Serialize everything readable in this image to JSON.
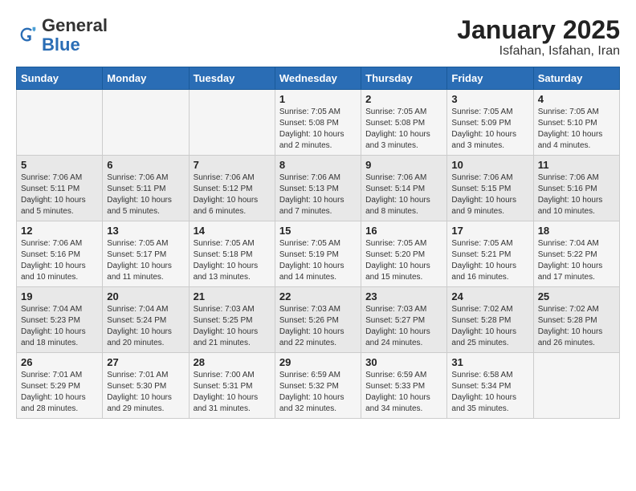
{
  "header": {
    "logo_general": "General",
    "logo_blue": "Blue",
    "title": "January 2025",
    "subtitle": "Isfahan, Isfahan, Iran"
  },
  "days_of_week": [
    "Sunday",
    "Monday",
    "Tuesday",
    "Wednesday",
    "Thursday",
    "Friday",
    "Saturday"
  ],
  "weeks": [
    [
      {
        "day": "",
        "info": ""
      },
      {
        "day": "",
        "info": ""
      },
      {
        "day": "",
        "info": ""
      },
      {
        "day": "1",
        "info": "Sunrise: 7:05 AM\nSunset: 5:08 PM\nDaylight: 10 hours and 2 minutes."
      },
      {
        "day": "2",
        "info": "Sunrise: 7:05 AM\nSunset: 5:08 PM\nDaylight: 10 hours and 3 minutes."
      },
      {
        "day": "3",
        "info": "Sunrise: 7:05 AM\nSunset: 5:09 PM\nDaylight: 10 hours and 3 minutes."
      },
      {
        "day": "4",
        "info": "Sunrise: 7:05 AM\nSunset: 5:10 PM\nDaylight: 10 hours and 4 minutes."
      }
    ],
    [
      {
        "day": "5",
        "info": "Sunrise: 7:06 AM\nSunset: 5:11 PM\nDaylight: 10 hours and 5 minutes."
      },
      {
        "day": "6",
        "info": "Sunrise: 7:06 AM\nSunset: 5:11 PM\nDaylight: 10 hours and 5 minutes."
      },
      {
        "day": "7",
        "info": "Sunrise: 7:06 AM\nSunset: 5:12 PM\nDaylight: 10 hours and 6 minutes."
      },
      {
        "day": "8",
        "info": "Sunrise: 7:06 AM\nSunset: 5:13 PM\nDaylight: 10 hours and 7 minutes."
      },
      {
        "day": "9",
        "info": "Sunrise: 7:06 AM\nSunset: 5:14 PM\nDaylight: 10 hours and 8 minutes."
      },
      {
        "day": "10",
        "info": "Sunrise: 7:06 AM\nSunset: 5:15 PM\nDaylight: 10 hours and 9 minutes."
      },
      {
        "day": "11",
        "info": "Sunrise: 7:06 AM\nSunset: 5:16 PM\nDaylight: 10 hours and 10 minutes."
      }
    ],
    [
      {
        "day": "12",
        "info": "Sunrise: 7:06 AM\nSunset: 5:16 PM\nDaylight: 10 hours and 10 minutes."
      },
      {
        "day": "13",
        "info": "Sunrise: 7:05 AM\nSunset: 5:17 PM\nDaylight: 10 hours and 11 minutes."
      },
      {
        "day": "14",
        "info": "Sunrise: 7:05 AM\nSunset: 5:18 PM\nDaylight: 10 hours and 13 minutes."
      },
      {
        "day": "15",
        "info": "Sunrise: 7:05 AM\nSunset: 5:19 PM\nDaylight: 10 hours and 14 minutes."
      },
      {
        "day": "16",
        "info": "Sunrise: 7:05 AM\nSunset: 5:20 PM\nDaylight: 10 hours and 15 minutes."
      },
      {
        "day": "17",
        "info": "Sunrise: 7:05 AM\nSunset: 5:21 PM\nDaylight: 10 hours and 16 minutes."
      },
      {
        "day": "18",
        "info": "Sunrise: 7:04 AM\nSunset: 5:22 PM\nDaylight: 10 hours and 17 minutes."
      }
    ],
    [
      {
        "day": "19",
        "info": "Sunrise: 7:04 AM\nSunset: 5:23 PM\nDaylight: 10 hours and 18 minutes."
      },
      {
        "day": "20",
        "info": "Sunrise: 7:04 AM\nSunset: 5:24 PM\nDaylight: 10 hours and 20 minutes."
      },
      {
        "day": "21",
        "info": "Sunrise: 7:03 AM\nSunset: 5:25 PM\nDaylight: 10 hours and 21 minutes."
      },
      {
        "day": "22",
        "info": "Sunrise: 7:03 AM\nSunset: 5:26 PM\nDaylight: 10 hours and 22 minutes."
      },
      {
        "day": "23",
        "info": "Sunrise: 7:03 AM\nSunset: 5:27 PM\nDaylight: 10 hours and 24 minutes."
      },
      {
        "day": "24",
        "info": "Sunrise: 7:02 AM\nSunset: 5:28 PM\nDaylight: 10 hours and 25 minutes."
      },
      {
        "day": "25",
        "info": "Sunrise: 7:02 AM\nSunset: 5:28 PM\nDaylight: 10 hours and 26 minutes."
      }
    ],
    [
      {
        "day": "26",
        "info": "Sunrise: 7:01 AM\nSunset: 5:29 PM\nDaylight: 10 hours and 28 minutes."
      },
      {
        "day": "27",
        "info": "Sunrise: 7:01 AM\nSunset: 5:30 PM\nDaylight: 10 hours and 29 minutes."
      },
      {
        "day": "28",
        "info": "Sunrise: 7:00 AM\nSunset: 5:31 PM\nDaylight: 10 hours and 31 minutes."
      },
      {
        "day": "29",
        "info": "Sunrise: 6:59 AM\nSunset: 5:32 PM\nDaylight: 10 hours and 32 minutes."
      },
      {
        "day": "30",
        "info": "Sunrise: 6:59 AM\nSunset: 5:33 PM\nDaylight: 10 hours and 34 minutes."
      },
      {
        "day": "31",
        "info": "Sunrise: 6:58 AM\nSunset: 5:34 PM\nDaylight: 10 hours and 35 minutes."
      },
      {
        "day": "",
        "info": ""
      }
    ]
  ]
}
